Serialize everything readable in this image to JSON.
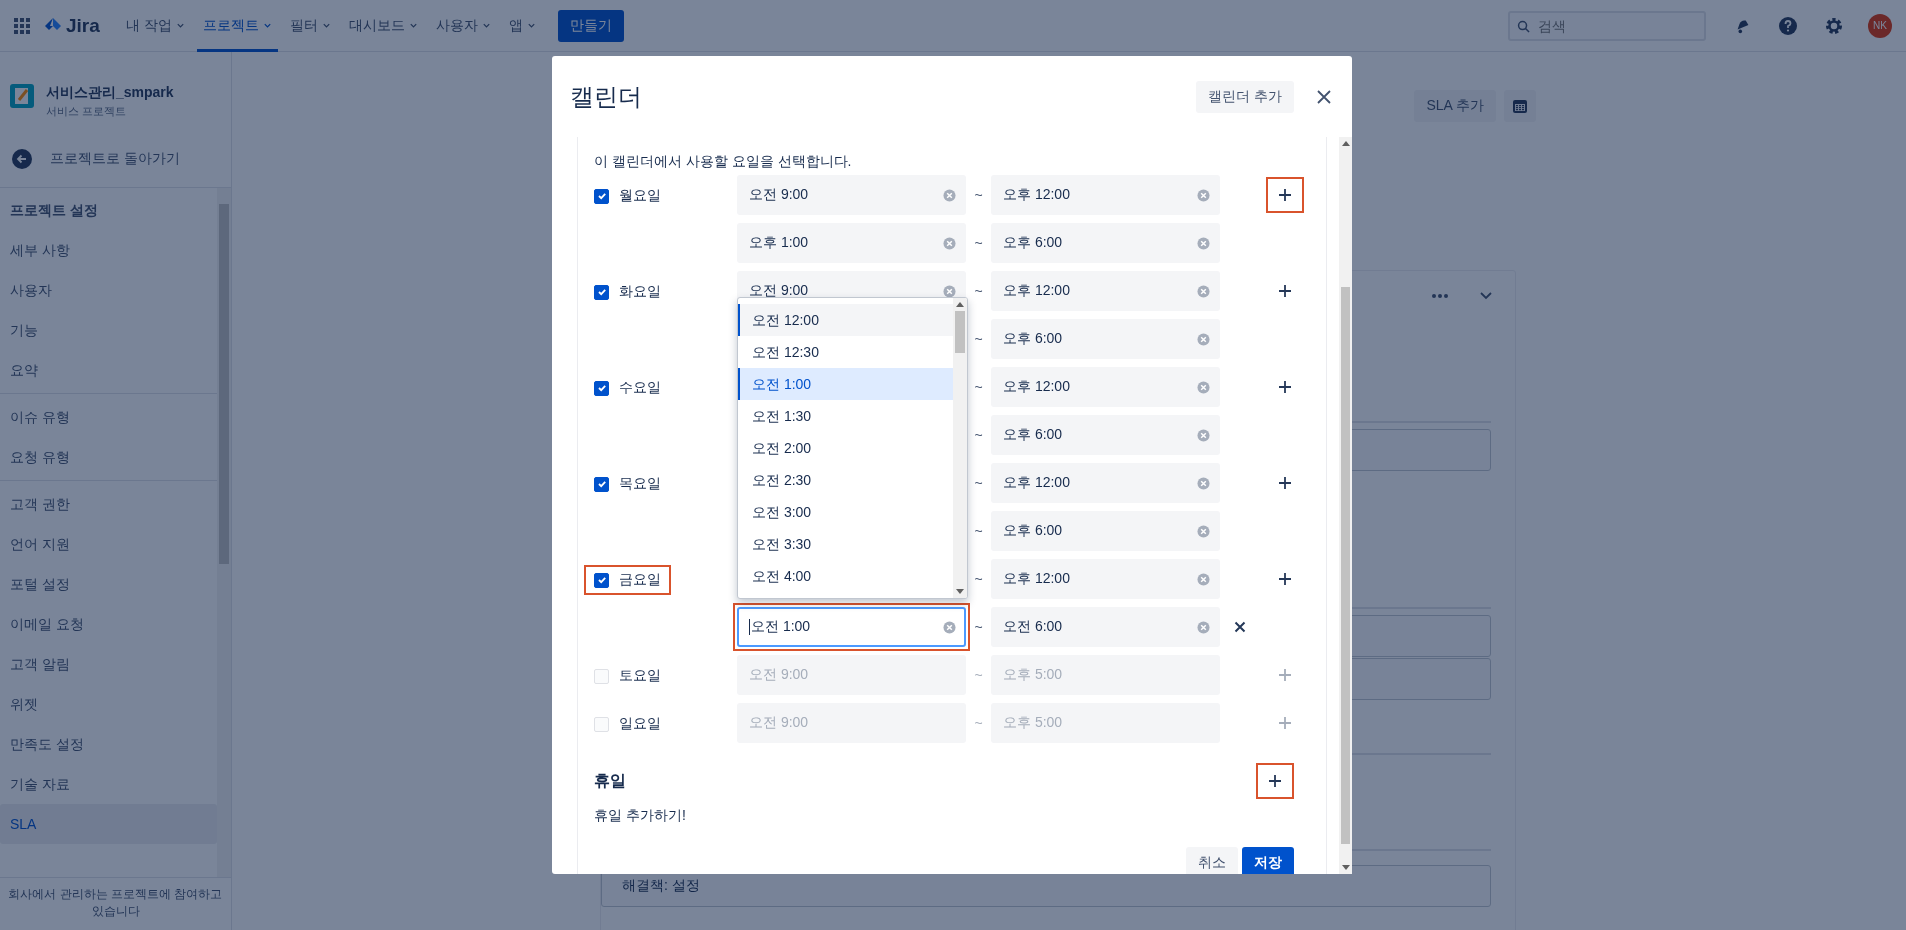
{
  "nav": {
    "logo": "Jira",
    "items": [
      {
        "label": "내 작업",
        "selected": false
      },
      {
        "label": "프로젝트",
        "selected": true
      },
      {
        "label": "필터",
        "selected": false
      },
      {
        "label": "대시보드",
        "selected": false
      },
      {
        "label": "사용자",
        "selected": false
      },
      {
        "label": "앱",
        "selected": false
      }
    ],
    "create_button": "만들기",
    "search": {
      "placeholder": "검색"
    },
    "avatar": "NK"
  },
  "sidebar": {
    "project_name": "서비스관리_smpark",
    "project_type": "서비스 프로젝트",
    "back_link": "프로젝트로 돌아가기",
    "section_title": "프로젝트 설정",
    "groups": [
      [
        {
          "label": "세부 사항",
          "selected": false
        },
        {
          "label": "사용자",
          "selected": false
        },
        {
          "label": "기능",
          "selected": false
        },
        {
          "label": "요약",
          "selected": false
        }
      ],
      [
        {
          "label": "이슈 유형",
          "selected": false
        },
        {
          "label": "요청 유형",
          "selected": false
        }
      ],
      [
        {
          "label": "고객 권한",
          "selected": false
        },
        {
          "label": "언어 지원",
          "selected": false
        },
        {
          "label": "포털 설정",
          "selected": false
        },
        {
          "label": "이메일 요청",
          "selected": false
        },
        {
          "label": "고객 알림",
          "selected": false
        },
        {
          "label": "위젯",
          "selected": false
        },
        {
          "label": "만족도 설정",
          "selected": false
        },
        {
          "label": "기술 자료",
          "selected": false
        },
        {
          "label": "SLA",
          "selected": true
        }
      ]
    ],
    "footer": "회사에서 관리하는 프로젝트에 참여하고 있습니다"
  },
  "main": {
    "add_sla_button": "SLA 추가",
    "resolution_label": "해결책: 설정"
  },
  "modal": {
    "title": "캘린더",
    "add_calendar_button": "캘린더 추가",
    "intro": "이 캘린더에서 사용할 요일을 선택합니다.",
    "days": [
      {
        "label": "월요일",
        "checked": true,
        "highlighted": false,
        "add_highlighted": true,
        "ranges": [
          {
            "from": {
              "value": "오전 9:00",
              "focused": false
            },
            "sep": "~",
            "to": {
              "value": "오후 12:00"
            }
          },
          {
            "from": {
              "value": "오후 1:00",
              "focused": false
            },
            "sep": "~",
            "to": {
              "value": "오후 6:00"
            }
          }
        ]
      },
      {
        "label": "화요일",
        "checked": true,
        "highlighted": false,
        "add_highlighted": false,
        "ranges": [
          {
            "from": {
              "value": "오전 9:00",
              "focused": false
            },
            "sep": "~",
            "to": {
              "value": "오후 12:00"
            }
          },
          {
            "sep": "~",
            "to": {
              "value": "오후 6:00"
            }
          }
        ]
      },
      {
        "label": "수요일",
        "checked": true,
        "highlighted": false,
        "add_highlighted": false,
        "ranges": [
          {
            "sep": "~",
            "to": {
              "value": "오후 12:00"
            }
          },
          {
            "sep": "~",
            "to": {
              "value": "오후 6:00"
            }
          }
        ]
      },
      {
        "label": "목요일",
        "checked": true,
        "highlighted": false,
        "add_highlighted": false,
        "ranges": [
          {
            "sep": "~",
            "to": {
              "value": "오후 12:00"
            }
          },
          {
            "sep": "~",
            "to": {
              "value": "오후 6:00"
            }
          }
        ]
      },
      {
        "label": "금요일",
        "checked": true,
        "highlighted": true,
        "add_highlighted": false,
        "ranges": [
          {
            "sep": "~",
            "to": {
              "value": "오후 12:00"
            }
          },
          {
            "from": {
              "value": "오전 1:00",
              "focused": true,
              "highlighted": true
            },
            "sep": "~",
            "to": {
              "value": "오전 6:00"
            },
            "removable": true
          }
        ]
      },
      {
        "label": "토요일",
        "checked": false,
        "highlighted": false,
        "add_highlighted": false,
        "ranges": [
          {
            "from": {
              "value": "오전 9:00",
              "focused": false
            },
            "sep": "~",
            "to": {
              "value": "오후 5:00"
            }
          }
        ]
      },
      {
        "label": "일요일",
        "checked": false,
        "highlighted": false,
        "add_highlighted": false,
        "ranges": [
          {
            "from": {
              "value": "오전 9:00",
              "focused": false
            },
            "sep": "~",
            "to": {
              "value": "오후 5:00"
            }
          }
        ]
      }
    ],
    "dropdown": {
      "options": [
        {
          "label": "오전 12:00",
          "selected": false,
          "hovered": true
        },
        {
          "label": "오전 12:30",
          "selected": false,
          "hovered": false
        },
        {
          "label": "오전 1:00",
          "selected": true,
          "hovered": false
        },
        {
          "label": "오전 1:30",
          "selected": false,
          "hovered": false
        },
        {
          "label": "오전 2:00",
          "selected": false,
          "hovered": false
        },
        {
          "label": "오전 2:30",
          "selected": false,
          "hovered": false
        },
        {
          "label": "오전 3:00",
          "selected": false,
          "hovered": false
        },
        {
          "label": "오전 3:30",
          "selected": false,
          "hovered": false
        },
        {
          "label": "오전 4:00",
          "selected": false,
          "hovered": false
        }
      ]
    },
    "holidays": {
      "title": "휴일",
      "add_highlighted": true,
      "empty_text": "휴일 추가하기!"
    },
    "buttons": {
      "cancel": "취소",
      "save": "저장"
    }
  }
}
